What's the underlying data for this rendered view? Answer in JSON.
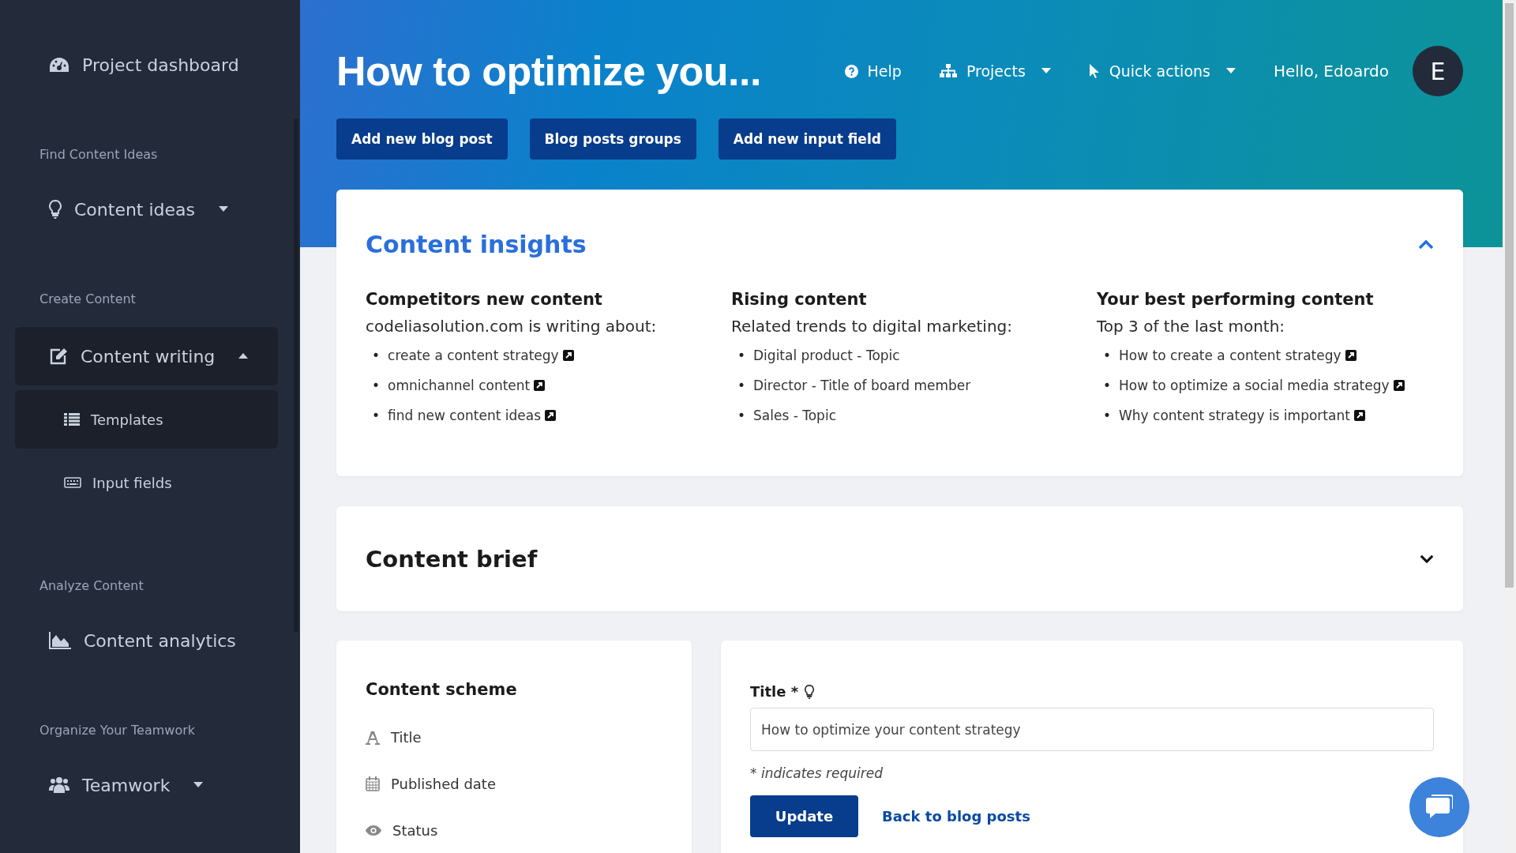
{
  "sidebar": {
    "sections": [
      {
        "items": [
          {
            "label": "Project dashboard",
            "kind": "link",
            "selected": false
          }
        ]
      },
      {
        "heading": "Find Content Ideas",
        "items": [
          {
            "label": "Content ideas",
            "kind": "dropdown",
            "expanded": false,
            "selected": false
          }
        ]
      },
      {
        "heading": "Create Content",
        "items": [
          {
            "label": "Content writing",
            "kind": "dropdown",
            "expanded": true,
            "selected": true,
            "children": [
              {
                "label": "Templates",
                "selected": true
              },
              {
                "label": "Input fields",
                "selected": false
              }
            ]
          }
        ]
      },
      {
        "heading": "Analyze Content",
        "items": [
          {
            "label": "Content analytics",
            "kind": "link",
            "selected": false
          }
        ]
      },
      {
        "heading": "Organize Your Teamwork",
        "items": [
          {
            "label": "Teamwork",
            "kind": "dropdown",
            "expanded": false,
            "selected": false
          }
        ]
      }
    ]
  },
  "header": {
    "title": "How to optimize you...",
    "nav": [
      {
        "label": "Help",
        "kind": "link"
      },
      {
        "label": "Projects",
        "kind": "dropdown"
      },
      {
        "label": "Quick actions",
        "kind": "dropdown"
      }
    ],
    "greeting": "Hello, Edoardo",
    "avatar": "E",
    "buttons": [
      "Add new blog post",
      "Blog posts groups",
      "Add new input field"
    ]
  },
  "insights": {
    "title": "Content insights",
    "expanded": true,
    "columns": [
      {
        "marker": "•",
        "heading": "Competitors new content",
        "subtitle": "codeliasolution.com is writing about:",
        "items": [
          {
            "text": "create a content strategy",
            "external": true
          },
          {
            "text": "omnichannel content",
            "external": true
          },
          {
            "text": "find new content ideas",
            "external": true
          }
        ]
      },
      {
        "marker": "•",
        "heading": "Rising content",
        "subtitle": "Related trends to digital marketing:",
        "items": [
          {
            "text": "Digital product - Topic",
            "external": false
          },
          {
            "text": "Director - Title of board member",
            "external": false
          },
          {
            "text": "Sales - Topic",
            "external": false
          }
        ]
      },
      {
        "marker": "•",
        "heading": "Your best performing content",
        "subtitle": "Top 3 of the last month:",
        "items": [
          {
            "text": "How to create a content strategy",
            "external": true
          },
          {
            "text": "How to optimize a social media strategy",
            "external": true
          },
          {
            "text": "Why content strategy is important",
            "external": true
          }
        ]
      }
    ]
  },
  "brief": {
    "title": "Content brief",
    "expanded": false
  },
  "scheme": {
    "title": "Content scheme",
    "fields": [
      "Title",
      "Published date",
      "Status"
    ]
  },
  "form": {
    "label": "Title *",
    "value": "How to optimize your content strategy",
    "note": "* indicates required",
    "submit": "Update",
    "back": "Back to blog posts"
  }
}
